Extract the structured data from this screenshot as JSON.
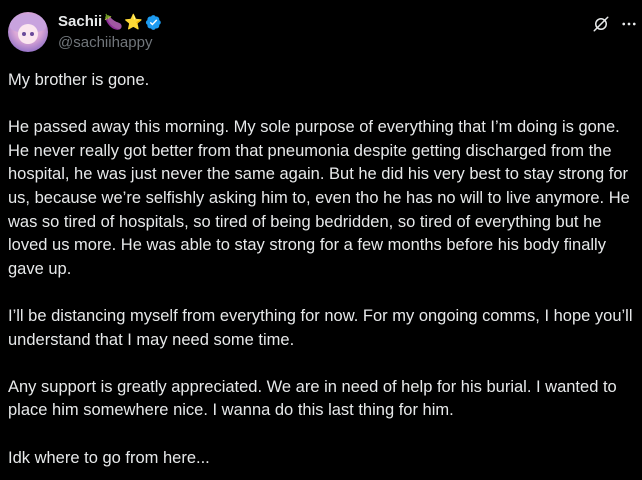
{
  "author": {
    "display_name": "Sachii",
    "emoji_1": "🍆",
    "emoji_2": "⭐",
    "handle": "@sachiihappy"
  },
  "icons": {
    "verified": "verified-badge-icon",
    "grok": "grok-icon",
    "more": "more-options-icon"
  },
  "colors": {
    "background": "#000000",
    "text": "#e7e9ea",
    "secondary_text": "#71767b",
    "verified": "#1d9bf0"
  },
  "post": {
    "paragraphs": [
      "My brother is gone.",
      "He passed away this morning. My sole purpose of everything that I’m doing is gone. He never really got better from that pneumonia despite getting discharged from the hospital, he was just never the same again. But he did his very best to stay strong for us, because we’re selfishly asking him to, even tho he has no will to live anymore. He was so tired of hospitals, so tired of being bedridden, so tired of everything but he loved us more. He was able to stay strong for a few months before his body finally gave up.",
      "I’ll be distancing myself from everything for now. For my ongoing comms, I hope you’ll understand that I may need some time.",
      "Any support is greatly appreciated. We are in need of help for his burial. I wanted to place him somewhere nice. I wanna do this last thing for him.",
      "Idk where to go from here..."
    ]
  }
}
